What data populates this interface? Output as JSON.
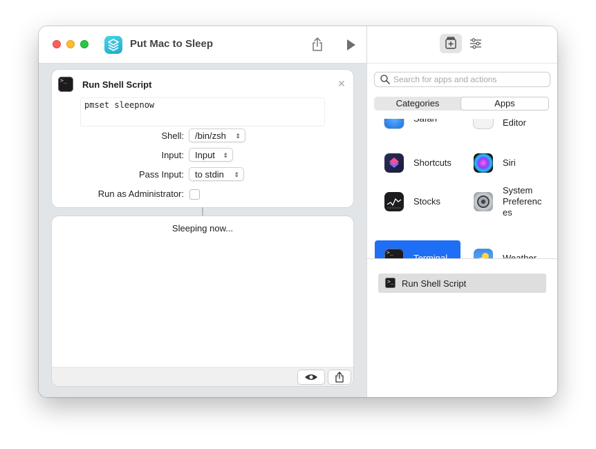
{
  "window": {
    "title": "Put Mac to Sleep"
  },
  "action": {
    "title": "Run Shell Script",
    "script": "pmset sleepnow",
    "params": [
      {
        "label": "Shell:",
        "value": "/bin/zsh"
      },
      {
        "label": "Input:",
        "value": "Input"
      },
      {
        "label": "Pass Input:",
        "value": "to stdin"
      }
    ],
    "admin_label": "Run as Administrator:"
  },
  "result": {
    "text": "Sleeping now..."
  },
  "sidebar": {
    "search_placeholder": "Search for apps and actions",
    "tabs": {
      "categories": "Categories",
      "apps": "Apps",
      "selected": "Apps"
    },
    "apps": {
      "safari": "Safari",
      "editor": "Editor",
      "shortcuts": "Shortcuts",
      "siri": "Siri",
      "stocks": "Stocks",
      "system_prefs_1": "System",
      "system_prefs_2": "Preferenc",
      "system_prefs_3": "es",
      "terminal": "Terminal",
      "weather": "Weather"
    },
    "selected_app": "Terminal",
    "actions": [
      {
        "label": "Run Shell Script",
        "icon": "terminal-icon"
      }
    ]
  },
  "colors": {
    "accent": "#1e6ff5",
    "close": "#fe5f57",
    "minimize": "#febc2e",
    "zoom": "#28c840"
  }
}
